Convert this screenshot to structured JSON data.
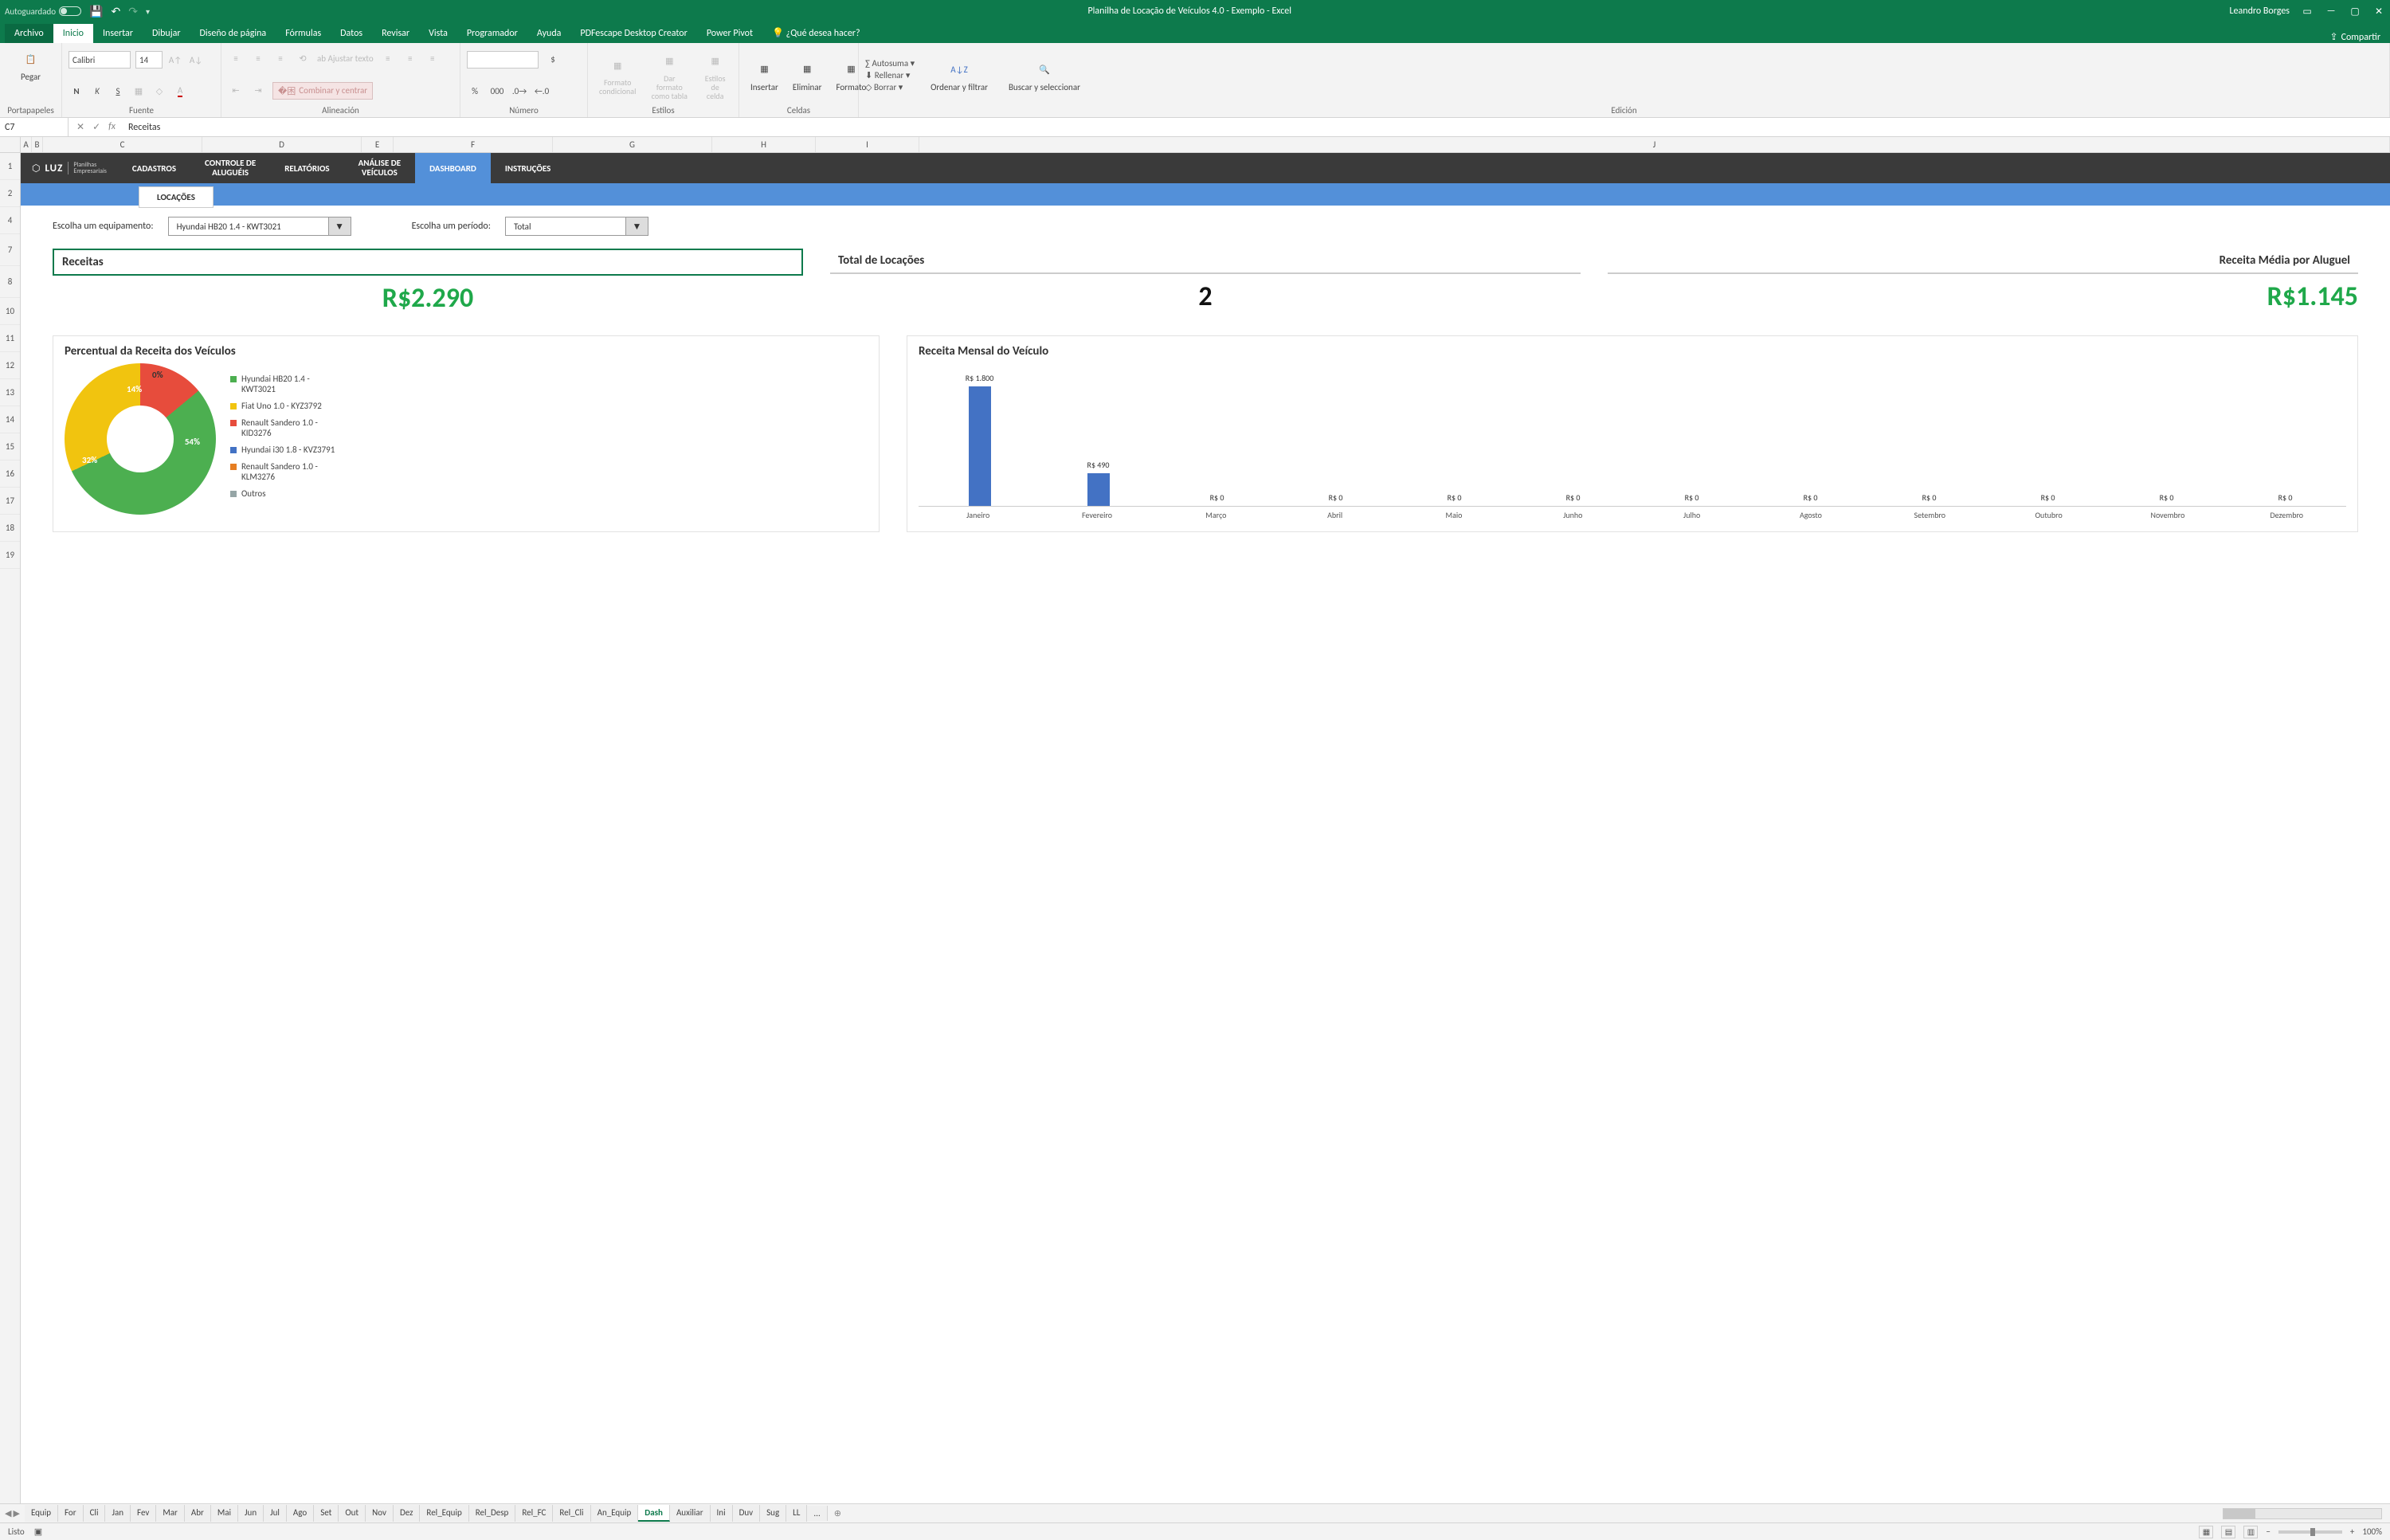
{
  "titlebar": {
    "autosave": "Autoguardado",
    "title": "Planilha de Locação de Veículos 4.0 - Exemplo  -  Excel",
    "user": "Leandro Borges"
  },
  "menutabs": {
    "file": "Archivo",
    "home": "Inicio",
    "insert": "Insertar",
    "draw": "Dibujar",
    "layout": "Diseño de página",
    "formulas": "Fórmulas",
    "data": "Datos",
    "review": "Revisar",
    "view": "Vista",
    "dev": "Programador",
    "help": "Ayuda",
    "pdfe": "PDFescape Desktop Creator",
    "pivot": "Power Pivot",
    "search": "¿Qué desea hacer?",
    "share": "Compartir"
  },
  "ribbon": {
    "paste": "Pegar",
    "clipboard": "Portapapeles",
    "font_name": "Calibri",
    "font_size": "14",
    "font": "Fuente",
    "wrap": "Ajustar texto",
    "merge": "Combinar y centrar",
    "alignment": "Alineación",
    "number": "Número",
    "cond": "Formato condicional",
    "table": "Dar formato como tabla",
    "cellstyle": "Estilos de celda",
    "styles": "Estilos",
    "ins": "Insertar",
    "del": "Eliminar",
    "fmt": "Formato",
    "cells": "Celdas",
    "autosum": "Autosuma",
    "fill": "Rellenar",
    "clear": "Borrar",
    "sort": "Ordenar y filtrar",
    "find": "Buscar y seleccionar",
    "editing": "Edición"
  },
  "formula": {
    "cell": "C7",
    "value": "Receitas"
  },
  "cols": [
    "A",
    "B",
    "C",
    "D",
    "E",
    "F",
    "G",
    "H",
    "I",
    "J"
  ],
  "rows": [
    "1",
    "2",
    "4",
    "7",
    "8",
    "10",
    "11",
    "12",
    "13",
    "14",
    "15",
    "16",
    "17",
    "18",
    "19"
  ],
  "nav": {
    "brand": "LUZ",
    "sub1": "Planilhas",
    "sub2": "Empresariais",
    "cadastros": "CADASTROS",
    "controle1": "CONTROLE DE",
    "controle2": "ALUGUÉIS",
    "relatorios": "RELATÓRIOS",
    "analise1": "ANÁLISE DE",
    "analise2": "VEÍCULOS",
    "dashboard": "DASHBOARD",
    "instrucoes": "INSTRUÇÕES",
    "subtab": "LOCAÇÕES"
  },
  "filters": {
    "equip_label": "Escolha um equipamento:",
    "equip_value": "Hyundai HB20 1.4 - KWT3021",
    "period_label": "Escolha um período:",
    "period_value": "Total"
  },
  "kpi": {
    "receitas_label": "Receitas",
    "receitas_value": "R$2.290",
    "total_label": "Total de Locações",
    "total_value": "2",
    "media_label": "Receita Média por Aluguel",
    "media_value": "R$1.145"
  },
  "donut": {
    "title": "Percentual da Receita dos Veículos",
    "pct_14": "14%",
    "pct_0": "0%",
    "pct_54": "54%",
    "pct_32": "32%"
  },
  "legend": {
    "l1": "Hyundai HB20 1.4 - KWT3021",
    "l2": "Fiat Uno 1.0 - KYZ3792",
    "l3": "Renault Sandero 1.0 - KID3276",
    "l4": "Hyundai i30 1.8 - KVZ3791",
    "l5": "Renault Sandero 1.0 - KLM3276",
    "l6": "Outros"
  },
  "bar": {
    "title": "Receita Mensal do Veículo"
  },
  "chart_data": [
    {
      "type": "pie",
      "title": "Percentual da Receita dos Veículos",
      "series": [
        {
          "name": "Hyundai HB20 1.4 - KWT3021",
          "value": 54,
          "color": "#4caf50"
        },
        {
          "name": "Fiat Uno 1.0 - KYZ3792",
          "value": 32,
          "color": "#f1c40f"
        },
        {
          "name": "Renault Sandero 1.0 - KID3276",
          "value": 14,
          "color": "#e74c3c"
        },
        {
          "name": "Hyundai i30 1.8 - KVZ3791",
          "value": 0,
          "color": "#4372c4"
        },
        {
          "name": "Renault Sandero 1.0 - KLM3276",
          "value": 0,
          "color": "#e67e22"
        },
        {
          "name": "Outros",
          "value": 0,
          "color": "#95a5a6"
        }
      ]
    },
    {
      "type": "bar",
      "title": "Receita Mensal do Veículo",
      "categories": [
        "Janeiro",
        "Fevereiro",
        "Março",
        "Abril",
        "Maio",
        "Junho",
        "Julho",
        "Agosto",
        "Setembro",
        "Outubro",
        "Novembro",
        "Dezembro"
      ],
      "values": [
        1800,
        490,
        0,
        0,
        0,
        0,
        0,
        0,
        0,
        0,
        0,
        0
      ],
      "value_labels": [
        "R$ 1.800",
        "R$ 490",
        "R$ 0",
        "R$ 0",
        "R$ 0",
        "R$ 0",
        "R$ 0",
        "R$ 0",
        "R$ 0",
        "R$ 0",
        "R$ 0",
        "R$ 0"
      ],
      "ylabel": "",
      "xlabel": "",
      "ylim": [
        0,
        1800
      ]
    }
  ],
  "sheets": [
    "Equip",
    "For",
    "Cli",
    "Jan",
    "Fev",
    "Mar",
    "Abr",
    "Mai",
    "Jun",
    "Jul",
    "Ago",
    "Set",
    "Out",
    "Nov",
    "Dez",
    "Rel_Equip",
    "Rel_Desp",
    "Rel_FC",
    "Rel_Cli",
    "An_Equip",
    "Dash",
    "Auxiliar",
    "Ini",
    "Duv",
    "Sug",
    "LL"
  ],
  "sheets_more": "...",
  "status": {
    "ready": "Listo",
    "zoom": "100%"
  }
}
